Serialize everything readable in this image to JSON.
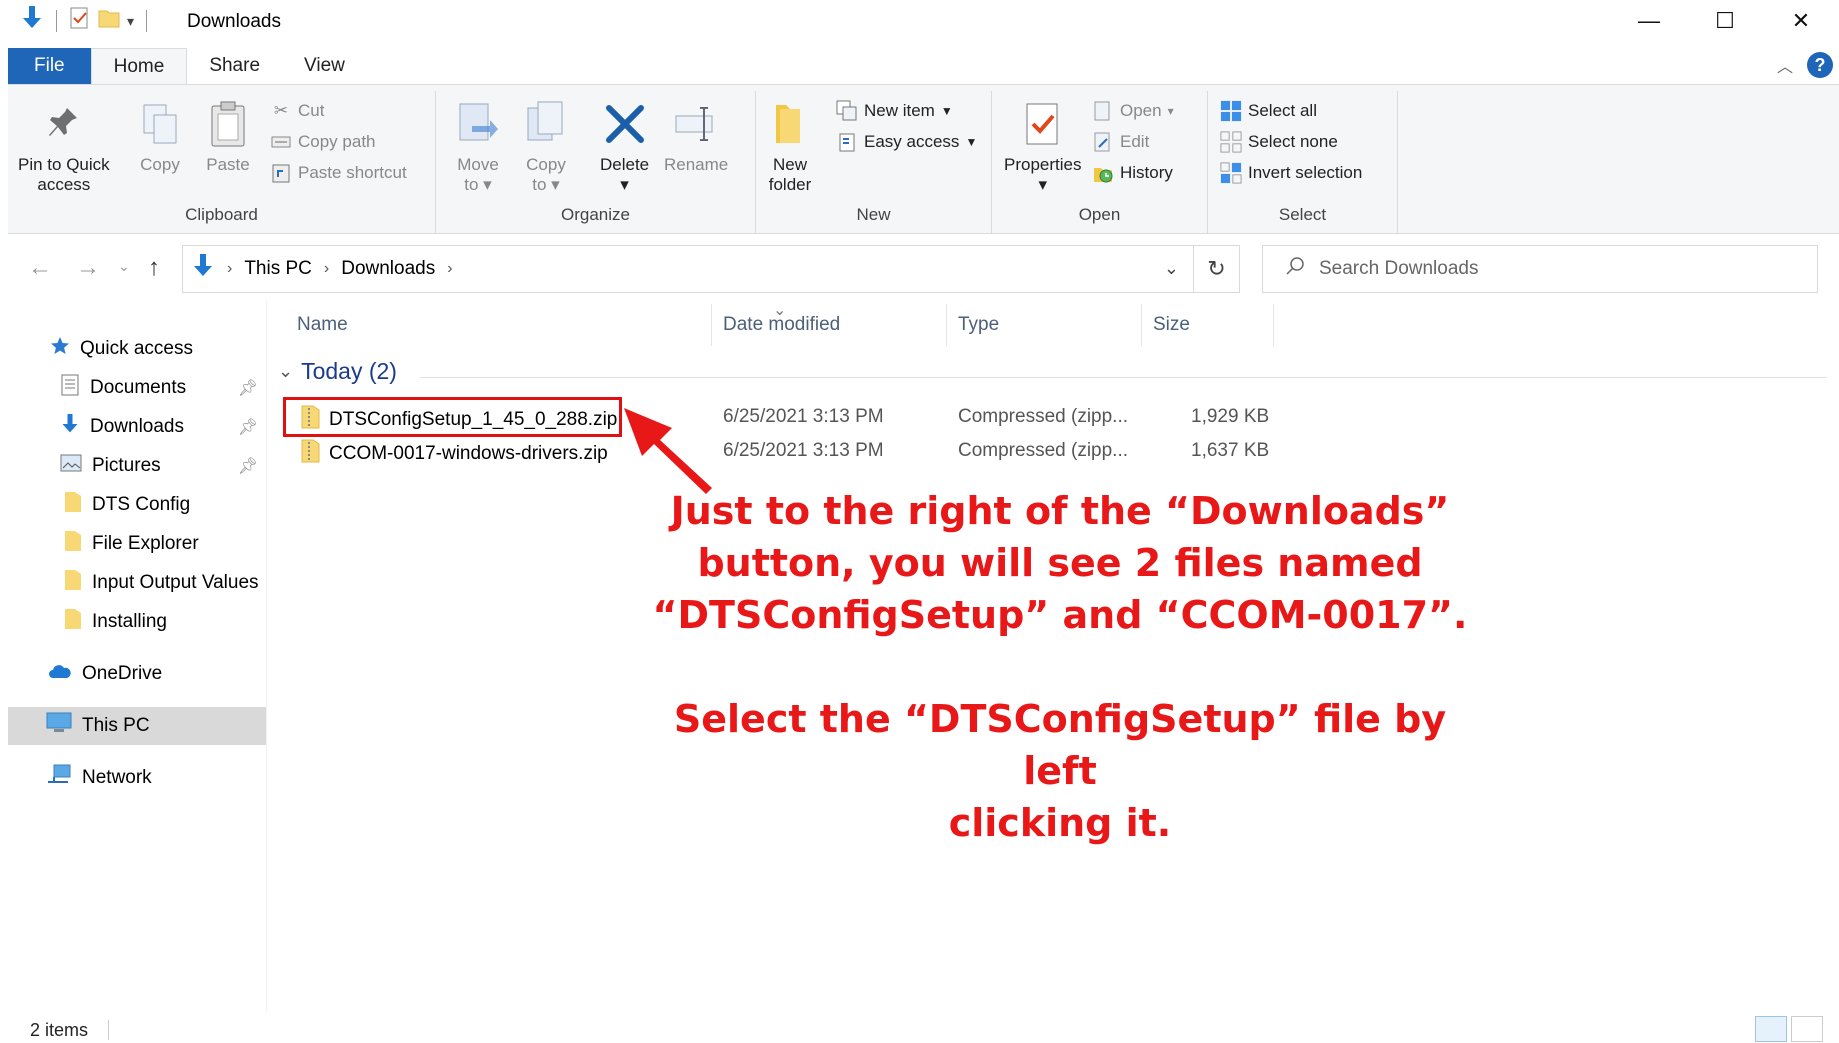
{
  "window": {
    "title": "Downloads",
    "minimize": "—",
    "maximize": "☐",
    "close": "✕"
  },
  "tabs": [
    {
      "label": "File"
    },
    {
      "label": "Home"
    },
    {
      "label": "Share"
    },
    {
      "label": "View"
    }
  ],
  "ribbon": {
    "clipboard": {
      "label": "Clipboard",
      "pin_line1": "Pin to Quick",
      "pin_line2": "access",
      "copy": "Copy",
      "paste": "Paste",
      "cut": "Cut",
      "copy_path": "Copy path",
      "paste_shortcut": "Paste shortcut"
    },
    "organize": {
      "label": "Organize",
      "move_line1": "Move",
      "move_line2": "to",
      "copy_line1": "Copy",
      "copy_line2": "to",
      "delete": "Delete",
      "rename": "Rename"
    },
    "new": {
      "label": "New",
      "new_folder_line1": "New",
      "new_folder_line2": "folder",
      "new_item": "New item",
      "easy_access": "Easy access"
    },
    "open": {
      "label": "Open",
      "properties": "Properties",
      "open": "Open",
      "edit": "Edit",
      "history": "History"
    },
    "select": {
      "label": "Select",
      "select_all": "Select all",
      "select_none": "Select none",
      "invert_selection": "Invert selection"
    }
  },
  "address": {
    "crumbs": [
      "This PC",
      "Downloads"
    ],
    "search_placeholder": "Search Downloads"
  },
  "navpane": {
    "items": [
      {
        "label": "Quick access"
      },
      {
        "label": "Documents"
      },
      {
        "label": "Downloads"
      },
      {
        "label": "Pictures"
      },
      {
        "label": "DTS Config"
      },
      {
        "label": "File Explorer"
      },
      {
        "label": "Input Output Values"
      },
      {
        "label": "Installing"
      },
      {
        "label": "OneDrive"
      },
      {
        "label": "This PC"
      },
      {
        "label": "Network"
      }
    ]
  },
  "columns": {
    "name": "Name",
    "date": "Date modified",
    "type": "Type",
    "size": "Size"
  },
  "group": {
    "label": "Today (2)"
  },
  "files": [
    {
      "name": "DTSConfigSetup_1_45_0_288.zip",
      "date": "6/25/2021 3:13 PM",
      "type": "Compressed (zipp...",
      "size": "1,929 KB"
    },
    {
      "name": "CCOM-0017-windows-drivers.zip",
      "date": "6/25/2021 3:13 PM",
      "type": "Compressed (zipp...",
      "size": "1,637 KB"
    }
  ],
  "annotation": {
    "line1": "Just to the right of the “Downloads”",
    "line2": "button, you will see 2 files named",
    "line3": "“DTSConfigSetup” and “CCOM-0017”.",
    "line4": "Select the “DTSConfigSetup” file by left",
    "line5": "clicking it.",
    "color": "#e81818"
  },
  "status": {
    "items": "2 items"
  },
  "colors": {
    "accent": "#1f65b8",
    "folder": "#f8d775",
    "highlight": "#e01010"
  }
}
